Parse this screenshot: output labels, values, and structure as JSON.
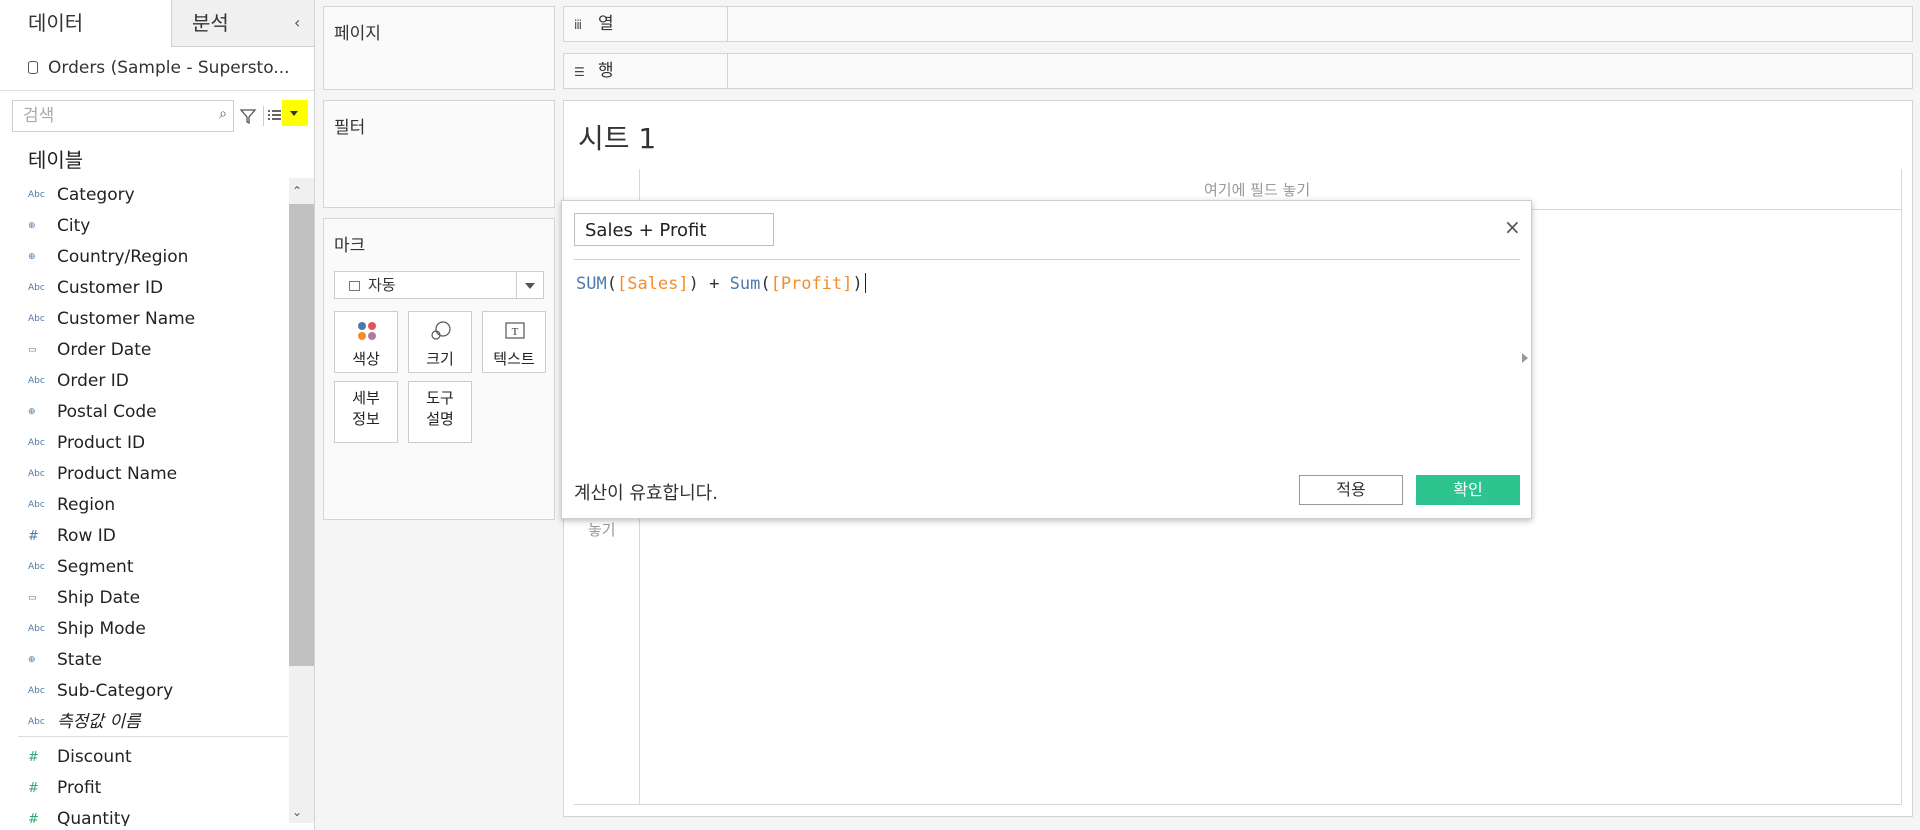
{
  "data_pane": {
    "tabs": [
      {
        "label": "데이터"
      },
      {
        "label": "분석"
      }
    ],
    "datasource": "Orders (Sample - Supersto...",
    "search_placeholder": "검색",
    "table_heading": "테이블",
    "dimensions": [
      {
        "type": "Abc",
        "name": "Category"
      },
      {
        "type": "⊕",
        "name": "City"
      },
      {
        "type": "⊕",
        "name": "Country/Region"
      },
      {
        "type": "Abc",
        "name": "Customer ID"
      },
      {
        "type": "Abc",
        "name": "Customer Name"
      },
      {
        "type": "▭",
        "name": "Order Date"
      },
      {
        "type": "Abc",
        "name": "Order ID"
      },
      {
        "type": "⊕",
        "name": "Postal Code"
      },
      {
        "type": "Abc",
        "name": "Product ID"
      },
      {
        "type": "Abc",
        "name": "Product Name"
      },
      {
        "type": "Abc",
        "name": "Region"
      },
      {
        "type": "#",
        "name": "Row ID"
      },
      {
        "type": "Abc",
        "name": "Segment"
      },
      {
        "type": "▭",
        "name": "Ship Date"
      },
      {
        "type": "Abc",
        "name": "Ship Mode"
      },
      {
        "type": "⊕",
        "name": "State"
      },
      {
        "type": "Abc",
        "name": "Sub-Category"
      },
      {
        "type": "Abc",
        "name": "측정값 이름"
      }
    ],
    "measures": [
      {
        "type": "#",
        "name": "Discount"
      },
      {
        "type": "#",
        "name": "Profit"
      },
      {
        "type": "#",
        "name": "Quantity"
      }
    ]
  },
  "cards": {
    "pages": "페이지",
    "filters": "필터",
    "marks": "마크",
    "mark_type": "자동",
    "mark_buttons": {
      "color": "색상",
      "size": "크기",
      "text": "텍스트",
      "detail_1": "세부",
      "detail_2": "정보",
      "tooltip_1": "도구",
      "tooltip_2": "설명"
    }
  },
  "shelves": {
    "columns": "열",
    "rows": "행"
  },
  "sheet": {
    "title": "시트 1",
    "drop_field_col": "여기에 필드 놓기",
    "drop_field_row": "놓기"
  },
  "calc_dialog": {
    "name": "Sales + Profit",
    "formula": {
      "f1": "SUM",
      "arg1": "[Sales]",
      "op": "+",
      "f2": "Sum",
      "arg2": "[Profit]"
    },
    "status": "계산이 유효합니다.",
    "apply_label": "적용",
    "ok_label": "확인"
  },
  "colors": {
    "accent_green": "#2ec490",
    "function_blue": "#4b7bb0",
    "field_orange": "#f28e2b",
    "highlight_yellow": "#ffff00"
  }
}
